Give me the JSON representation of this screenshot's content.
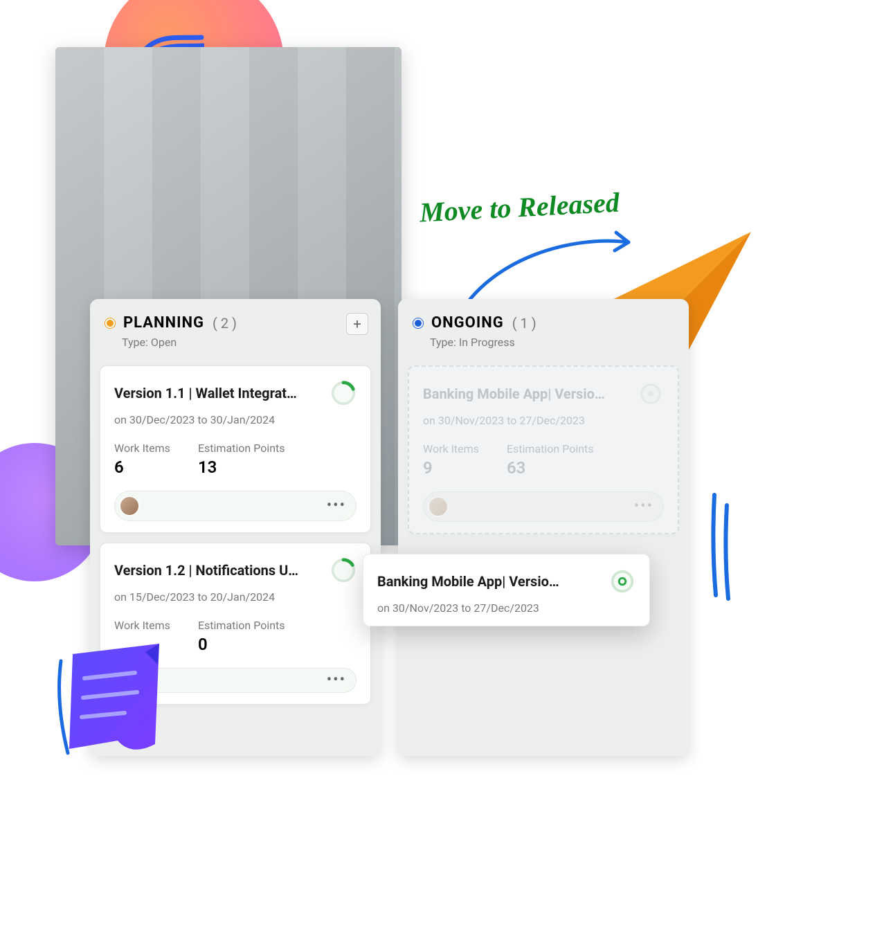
{
  "annotation": {
    "label": "Move to Released"
  },
  "columns": {
    "planning": {
      "title": "PLANNING",
      "count": "( 2 )",
      "subtitle": "Type: Open",
      "status_color": "#f29d1b"
    },
    "ongoing": {
      "title": "ONGOING",
      "count": "( 1 )",
      "subtitle": "Type: In Progress",
      "status_color": "#1b5fd6"
    }
  },
  "cards": {
    "planning": [
      {
        "title": "Version 1.1 | Wallet Integrat…",
        "date": "on 30/Dec/2023 to 30/Jan/2024",
        "work_items_label": "Work Items",
        "work_items_value": "6",
        "points_label": "Estimation Points",
        "points_value": "13"
      },
      {
        "title": "Version 1.2 | Notifications U…",
        "date": "on 15/Dec/2023 to 20/Jan/2024",
        "work_items_label": "Work Items",
        "work_items_value": "",
        "points_label": "Estimation Points",
        "points_value": "0"
      }
    ],
    "ongoing_ghost": {
      "title": "Banking Mobile App| Versio…",
      "date": "on 30/Nov/2023 to 27/Dec/2023",
      "work_items_label": "Work Items",
      "work_items_value": "9",
      "points_label": "Estimation Points",
      "points_value": "63"
    },
    "floating": {
      "title": "Banking Mobile App| Versio…",
      "date": "on 30/Nov/2023 to 27/Dec/2023"
    }
  }
}
